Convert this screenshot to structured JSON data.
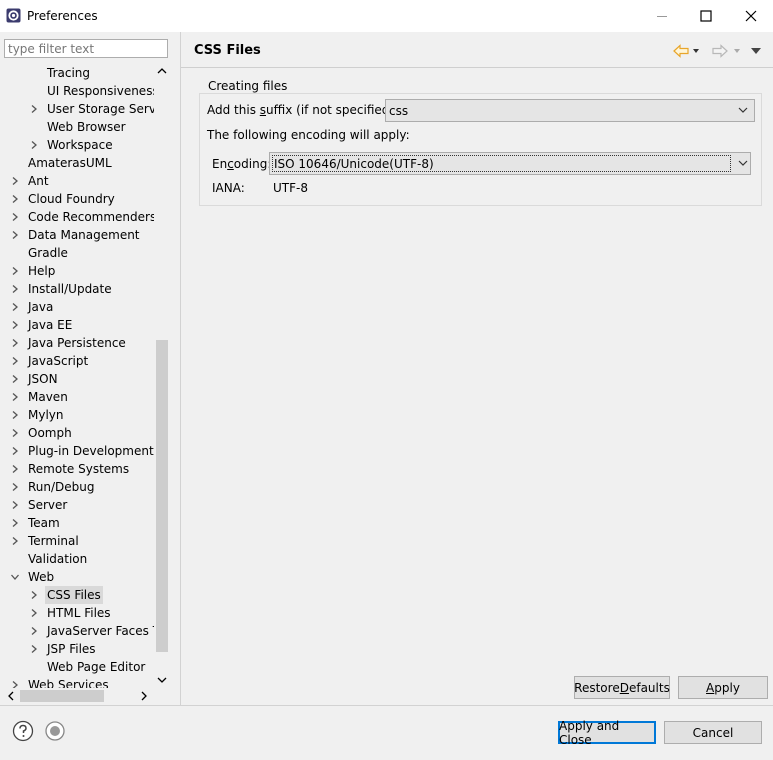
{
  "window": {
    "title": "Preferences"
  },
  "filter": {
    "placeholder": "type filter text"
  },
  "tree": {
    "items": [
      {
        "label": "Tracing",
        "level": 2,
        "twisty": "none"
      },
      {
        "label": "UI Responsiveness M",
        "level": 2,
        "twisty": "none"
      },
      {
        "label": "User Storage Servic",
        "level": 2,
        "twisty": "closed"
      },
      {
        "label": "Web Browser",
        "level": 2,
        "twisty": "none"
      },
      {
        "label": "Workspace",
        "level": 2,
        "twisty": "closed"
      },
      {
        "label": "AmaterasUML",
        "level": 1,
        "twisty": "none"
      },
      {
        "label": "Ant",
        "level": 1,
        "twisty": "closed"
      },
      {
        "label": "Cloud Foundry",
        "level": 1,
        "twisty": "closed"
      },
      {
        "label": "Code Recommenders",
        "level": 1,
        "twisty": "closed"
      },
      {
        "label": "Data Management",
        "level": 1,
        "twisty": "closed"
      },
      {
        "label": "Gradle",
        "level": 1,
        "twisty": "none"
      },
      {
        "label": "Help",
        "level": 1,
        "twisty": "closed"
      },
      {
        "label": "Install/Update",
        "level": 1,
        "twisty": "closed"
      },
      {
        "label": "Java",
        "level": 1,
        "twisty": "closed"
      },
      {
        "label": "Java EE",
        "level": 1,
        "twisty": "closed"
      },
      {
        "label": "Java Persistence",
        "level": 1,
        "twisty": "closed"
      },
      {
        "label": "JavaScript",
        "level": 1,
        "twisty": "closed"
      },
      {
        "label": "JSON",
        "level": 1,
        "twisty": "closed"
      },
      {
        "label": "Maven",
        "level": 1,
        "twisty": "closed"
      },
      {
        "label": "Mylyn",
        "level": 1,
        "twisty": "closed"
      },
      {
        "label": "Oomph",
        "level": 1,
        "twisty": "closed"
      },
      {
        "label": "Plug-in Development",
        "level": 1,
        "twisty": "closed"
      },
      {
        "label": "Remote Systems",
        "level": 1,
        "twisty": "closed"
      },
      {
        "label": "Run/Debug",
        "level": 1,
        "twisty": "closed"
      },
      {
        "label": "Server",
        "level": 1,
        "twisty": "closed"
      },
      {
        "label": "Team",
        "level": 1,
        "twisty": "closed"
      },
      {
        "label": "Terminal",
        "level": 1,
        "twisty": "closed"
      },
      {
        "label": "Validation",
        "level": 1,
        "twisty": "none"
      },
      {
        "label": "Web",
        "level": 1,
        "twisty": "open"
      },
      {
        "label": "CSS Files",
        "level": 2,
        "twisty": "closed",
        "selected": true
      },
      {
        "label": "HTML Files",
        "level": 2,
        "twisty": "closed"
      },
      {
        "label": "JavaServer Faces To",
        "level": 2,
        "twisty": "closed"
      },
      {
        "label": "JSP Files",
        "level": 2,
        "twisty": "closed"
      },
      {
        "label": "Web Page Editor",
        "level": 2,
        "twisty": "none"
      },
      {
        "label": "Web Services",
        "level": 1,
        "twisty": "closed"
      }
    ]
  },
  "page": {
    "title": "CSS Files",
    "group_label": "Creating files",
    "suffix_label_pre": "Add this ",
    "suffix_label_mn": "s",
    "suffix_label_post": "uffix (if not specified):",
    "suffix_value": "css",
    "encoding_note": "The following encoding will apply:",
    "encoding_label_pre": "En",
    "encoding_label_mn": "c",
    "encoding_label_post": "oding:",
    "encoding_value": "ISO 10646/Unicode(UTF-8)",
    "iana_label": "IANA:",
    "iana_value": "UTF-8"
  },
  "buttons": {
    "restore_pre": "Restore ",
    "restore_mn": "D",
    "restore_post": "efaults",
    "apply_mn": "A",
    "apply_post": "pply",
    "apply_close": "Apply and Close",
    "cancel": "Cancel"
  },
  "colors": {
    "back_arrow": "#e8a52a",
    "forward_arrow": "#b8b8b8",
    "focus_border": "#0078d7"
  }
}
